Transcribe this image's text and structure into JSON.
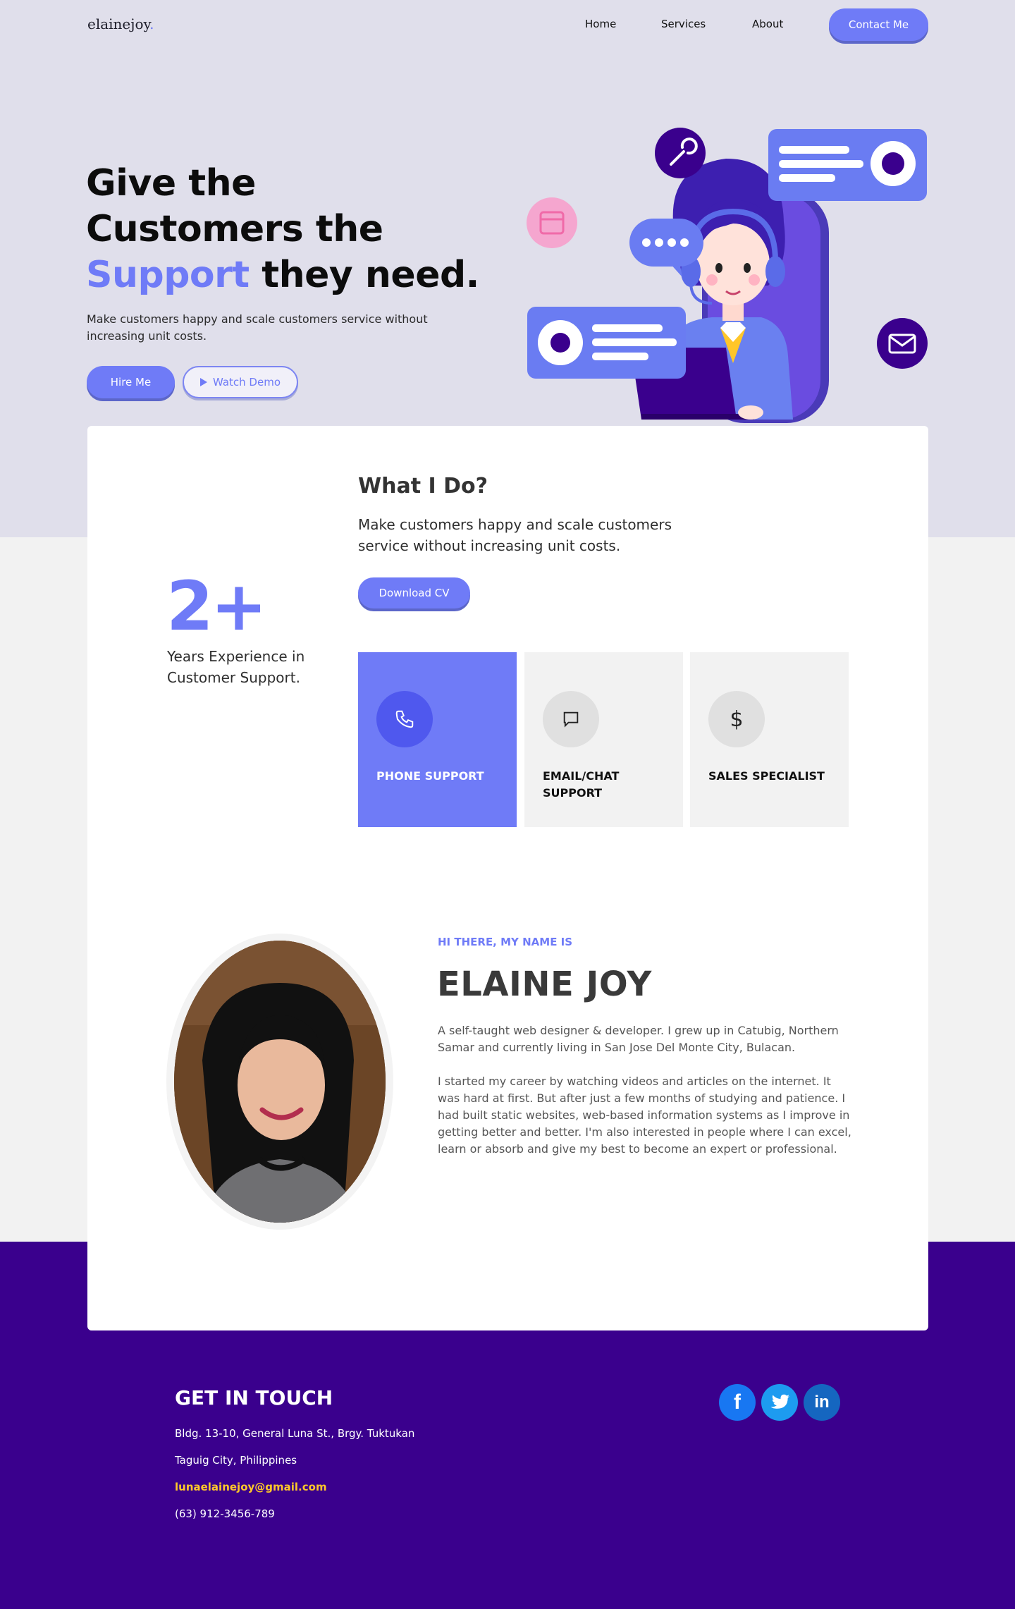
{
  "nav": {
    "logo": "elainejoy",
    "logo_dot": ".",
    "links": [
      "Home",
      "Services",
      "About"
    ],
    "contact": "Contact Me"
  },
  "hero": {
    "title_line1": "Give the",
    "title_line2": "Customers the",
    "title_accent": "Support",
    "title_end": " they need.",
    "subtitle": "Make customers happy and scale customers service without increasing unit costs.",
    "hire": "Hire Me",
    "demo": "Watch Demo"
  },
  "what": {
    "title": "What I Do?",
    "subtitle": "Make customers happy and scale customers service without increasing unit costs.",
    "cv": "Download CV"
  },
  "experience": {
    "number": "2+",
    "text": "Years Experience in Customer Support."
  },
  "services": [
    {
      "label": "PHONE SUPPORT",
      "icon": "phone-icon"
    },
    {
      "label": "EMAIL/CHAT SUPPORT",
      "icon": "chat-icon"
    },
    {
      "label": "SALES SPECIALIST",
      "icon": "dollar-icon"
    }
  ],
  "about": {
    "greeting": "HI THERE, MY NAME IS",
    "name": "ELAINE JOY",
    "bio1": "A self-taught web designer & developer. I grew up in Catubig, Northern Samar and currently living in San Jose Del Monte City, Bulacan.",
    "bio2": "I started my career by watching videos and articles on the internet. It was hard at first. But after just a few months of studying and patience. I had built static websites, web-based information systems as I improve in getting better and better. I'm also interested in people where I can excel, learn or absorb and give my best to become an expert or professional."
  },
  "footer": {
    "title": "GET IN TOUCH",
    "address1": "Bldg. 13-10, General Luna St., Brgy. Tuktukan",
    "address2": "Taguig City, Philippines",
    "email": "lunaelainejoy@gmail.com",
    "phone": "(63) 912-3456-789",
    "social": [
      "facebook-icon",
      "twitter-icon",
      "linkedin-icon"
    ]
  },
  "colors": {
    "accent": "#6f7bf7",
    "hero_bg": "#e0dfeb",
    "footer_bg": "#3a008d",
    "email": "#ffc829"
  }
}
